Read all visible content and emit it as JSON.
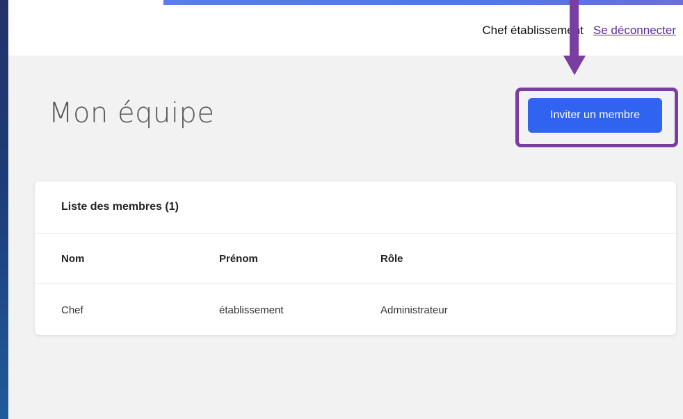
{
  "header": {
    "user_name": "Chef établissement",
    "logout_label": "Se déconnecter"
  },
  "page": {
    "title": "Mon équipe",
    "invite_button_label": "Inviter un membre"
  },
  "members": {
    "list_title": "Liste des membres (1)",
    "columns": [
      "Nom",
      "Prénom",
      "Rôle"
    ],
    "rows": [
      [
        "Chef",
        "établissement",
        "Administrateur"
      ]
    ]
  },
  "colors": {
    "accent": "#2f63f0",
    "annotation": "#7a3ea0",
    "sidebar": "#1c3d78",
    "background": "#f2f2f2"
  }
}
